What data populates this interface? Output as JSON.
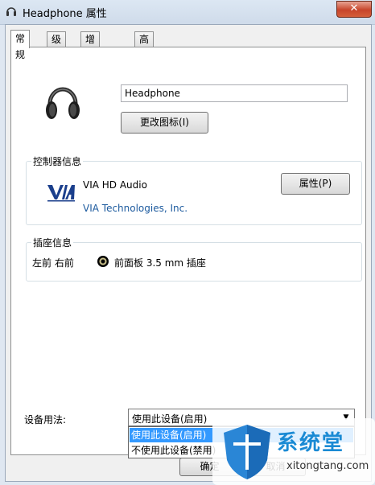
{
  "window": {
    "title": "Headphone 属性",
    "close_label": "✕"
  },
  "tabs": [
    {
      "label": "常规",
      "active": true
    },
    {
      "label": "级别",
      "active": false
    },
    {
      "label": "增强功能",
      "active": false
    },
    {
      "label": "高级",
      "active": false
    }
  ],
  "device": {
    "name_value": "Headphone",
    "change_icon_label": "更改图标(I)",
    "icon": "headphone-icon"
  },
  "controller": {
    "group_label": "控制器信息",
    "name": "VIA HD Audio",
    "vendor": "VIA Technologies, Inc.",
    "properties_label": "属性(P)",
    "logo": "via-logo"
  },
  "jack": {
    "group_label": "插座信息",
    "channels": "左前 右前",
    "description": "前面板 3.5 mm 插座",
    "icon": "audio-jack-icon"
  },
  "usage": {
    "label": "设备用法:",
    "selected": "使用此设备(启用)",
    "options": [
      "使用此设备(启用)",
      "不使用此设备(禁用)"
    ]
  },
  "footer": {
    "ok_label": "确定",
    "cancel_label": "取消"
  },
  "watermark": {
    "title": "系统堂",
    "url": "xitongtang.com"
  },
  "colors": {
    "selection": "#3399ff",
    "vendor_link": "#1c5a9e"
  }
}
